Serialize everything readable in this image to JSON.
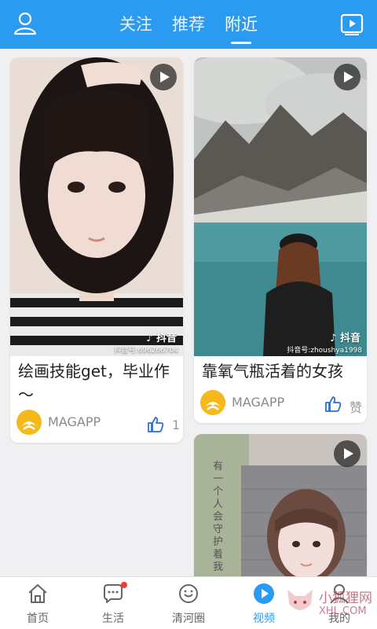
{
  "header": {
    "tabs": [
      {
        "label": "关注",
        "active": false
      },
      {
        "label": "推荐",
        "active": false
      },
      {
        "label": "附近",
        "active": true
      }
    ],
    "icons": {
      "left": "user-icon",
      "right": "video-play-icon"
    },
    "accent": "#2a9bf0"
  },
  "feed": {
    "cards": [
      {
        "title": "绘画技能get，毕业作～",
        "watermark_logo": "抖音",
        "watermark_id": "抖音号:696266704",
        "author": "MAGAPP",
        "like_count": "1"
      },
      {
        "title": "靠氧气瓶活着的女孩",
        "watermark_logo": "抖音",
        "watermark_id": "抖音号:zhoushya1998",
        "author": "MAGAPP",
        "like_count": "赞"
      },
      {
        "title": "",
        "overlay_text": "有一个人会守护着我"
      }
    ]
  },
  "bottom_nav": {
    "items": [
      {
        "label": "首页",
        "icon": "home-icon"
      },
      {
        "label": "生活",
        "icon": "chat-bubble-icon"
      },
      {
        "label": "清河圈",
        "icon": "circle-chat-icon"
      },
      {
        "label": "视频",
        "icon": "video-play-icon",
        "active": true
      },
      {
        "label": "我的",
        "icon": "person-icon"
      }
    ]
  },
  "watermark": {
    "text": "小狐狸网",
    "sub": "XHL.COM"
  }
}
